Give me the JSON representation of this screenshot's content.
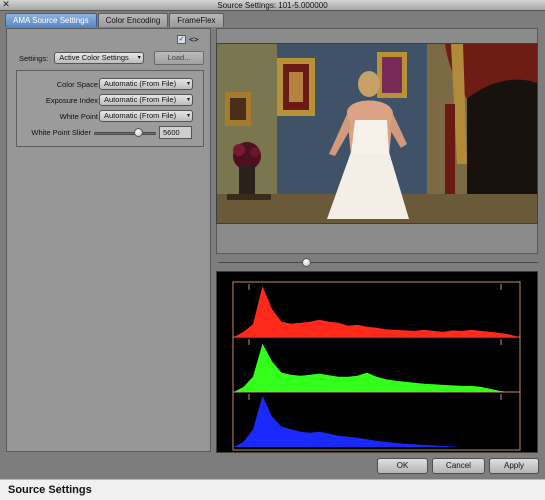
{
  "window": {
    "title": "Source Settings: 101-5.000000"
  },
  "tabs": [
    {
      "label": "AMA Source Settings",
      "active": true
    },
    {
      "label": "Color Encoding",
      "active": false
    },
    {
      "label": "FrameFlex",
      "active": false
    }
  ],
  "panel": {
    "settings_label": "Settings:",
    "settings_value": "Active Color Settings",
    "load_label": "Load...",
    "properties": [
      {
        "label": "Color Space",
        "value": "Automatic (From File)"
      },
      {
        "label": "Exposure Index",
        "value": "Automatic (From File)"
      },
      {
        "label": "White Point",
        "value": "Automatic (From File)"
      }
    ],
    "white_point_slider": {
      "label": "White Point Slider",
      "value": "5600",
      "fraction": 0.72
    }
  },
  "viewer": {
    "scrub_position": 0.27
  },
  "icons": {
    "close": "close-icon",
    "checkbox": "checkbox-icon",
    "code": "code-arrows-icon",
    "caret": "chevron-down-icon"
  },
  "histogram": {
    "channels": [
      {
        "name": "red",
        "color": "#ff2a1a",
        "levels": [
          0,
          0.1,
          0.25,
          1.0,
          0.55,
          0.3,
          0.26,
          0.28,
          0.3,
          0.34,
          0.3,
          0.28,
          0.22,
          0.24,
          0.2,
          0.18,
          0.15,
          0.14,
          0.13,
          0.12,
          0.14,
          0.12,
          0.1,
          0.13,
          0.12,
          0.14,
          0.12,
          0.1,
          0.08,
          0.05,
          0
        ]
      },
      {
        "name": "green",
        "color": "#32ff1a",
        "levels": [
          0,
          0.1,
          0.3,
          0.95,
          0.6,
          0.38,
          0.34,
          0.32,
          0.34,
          0.36,
          0.33,
          0.3,
          0.3,
          0.32,
          0.38,
          0.3,
          0.25,
          0.22,
          0.2,
          0.18,
          0.16,
          0.15,
          0.14,
          0.13,
          0.12,
          0.12,
          0.1,
          0.06,
          0.02,
          0,
          0
        ]
      },
      {
        "name": "blue",
        "color": "#1a2aff",
        "levels": [
          0,
          0.1,
          0.35,
          1.0,
          0.6,
          0.4,
          0.35,
          0.3,
          0.28,
          0.3,
          0.26,
          0.22,
          0.2,
          0.18,
          0.15,
          0.12,
          0.1,
          0.08,
          0.06,
          0.05,
          0.04,
          0.03,
          0.02,
          0.01,
          0,
          0,
          0,
          0,
          0,
          0,
          0
        ]
      }
    ]
  },
  "buttons": {
    "ok": "OK",
    "cancel": "Cancel",
    "apply": "Apply"
  },
  "statusbar": {
    "text": "Source Settings"
  }
}
